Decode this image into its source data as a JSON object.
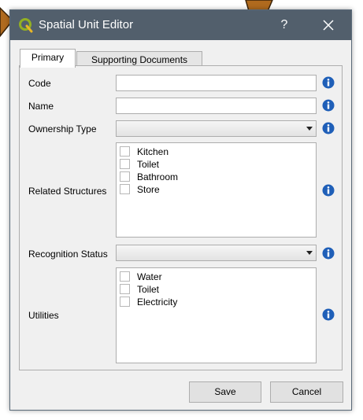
{
  "dialog": {
    "title": "Spatial Unit Editor",
    "help_label": "?"
  },
  "tabs": [
    {
      "label": "Primary",
      "active": true
    },
    {
      "label": "Supporting Documents",
      "active": false
    }
  ],
  "form": {
    "code_label": "Code",
    "code_value": "",
    "name_label": "Name",
    "name_value": "",
    "ownership_label": "Ownership Type",
    "ownership_value": "",
    "related_structures_label": "Related Structures",
    "related_structures": [
      "Kitchen",
      "Toilet",
      "Bathroom",
      "Store"
    ],
    "recognition_label": "Recognition Status",
    "recognition_value": "",
    "utilities_label": "Utilities",
    "utilities": [
      "Water",
      "Toilet",
      "Electricity"
    ]
  },
  "buttons": {
    "save_label": "Save",
    "cancel_label": "Cancel"
  },
  "colors": {
    "titlebar": "#525f6c",
    "info_icon": "#1f5fb8",
    "background_shape": "#b06a1e"
  },
  "icons": [
    "qgis-logo-icon",
    "close-icon",
    "info-icon",
    "chevron-down-icon"
  ]
}
